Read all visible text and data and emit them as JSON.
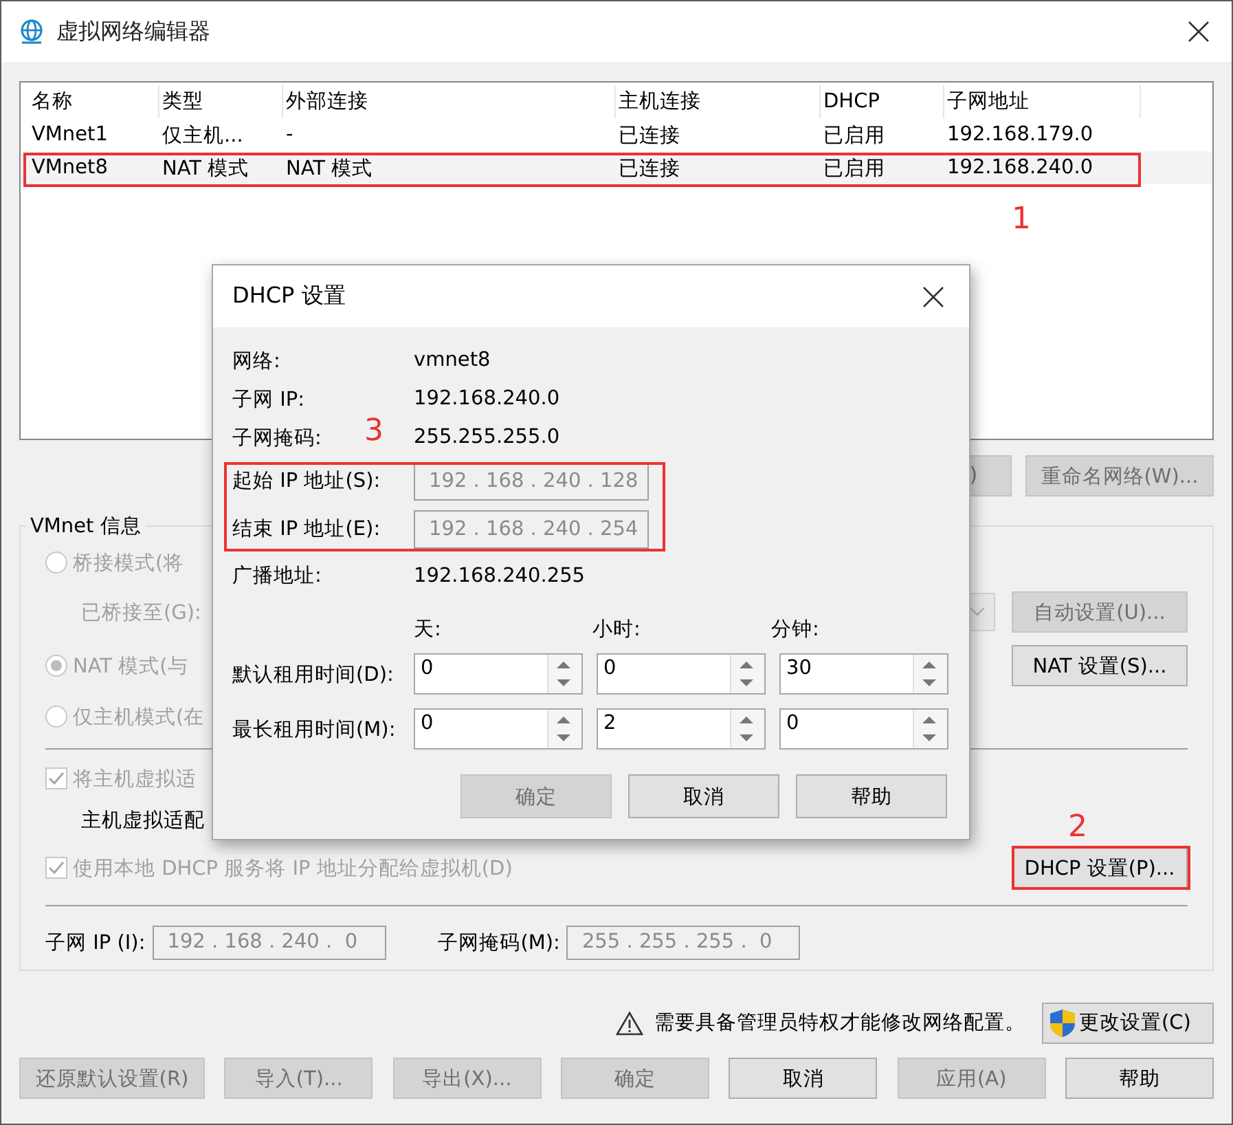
{
  "window": {
    "title": "虚拟网络编辑器"
  },
  "network_table": {
    "columns": [
      "名称",
      "类型",
      "外部连接",
      "主机连接",
      "DHCP",
      "子网地址"
    ],
    "rows": [
      {
        "cells": [
          "VMnet1",
          "仅主机...",
          "-",
          "已连接",
          "已启用",
          "192.168.179.0"
        ],
        "selected": false
      },
      {
        "cells": [
          "VMnet8",
          "NAT 模式",
          "NAT 模式",
          "已连接",
          "已启用",
          "192.168.240.0"
        ],
        "selected": true
      }
    ]
  },
  "network_buttons": [
    {
      "label": ")",
      "disabled": true
    },
    {
      "label": "重命名网络(W)...",
      "disabled": true
    }
  ],
  "vmnet_info": {
    "title": "VMnet 信息",
    "modes": [
      {
        "label": "桥接模式(将",
        "selected": false,
        "disabled": true
      },
      {
        "label": "NAT 模式(与",
        "selected": true,
        "disabled": true
      },
      {
        "label": "仅主机模式(在",
        "selected": false,
        "disabled": true
      }
    ],
    "bridged_to": {
      "label": "已桥接至(G):",
      "disabled": true
    },
    "auto_button": {
      "label": "自动设置(U)...",
      "disabled": true
    },
    "nat_button": {
      "label": "NAT 设置(S)...",
      "disabled": false
    },
    "connect_adapter": {
      "label": "将主机虚拟适",
      "checked": true,
      "disabled": true
    },
    "adapter_name": "主机虚拟适配",
    "use_dhcp": {
      "label": "使用本地 DHCP 服务将 IP 地址分配给虚拟机(D)",
      "checked": true,
      "disabled": true
    },
    "dhcp_button": {
      "label": "DHCP 设置(P)...",
      "disabled": false
    },
    "subnet_fields": [
      {
        "label": "子网 IP (I):",
        "value": "192 . 168 . 240 .  0",
        "disabled": true
      },
      {
        "label": "子网掩码(M):",
        "value": "255 . 255 . 255 .  0",
        "disabled": true
      }
    ]
  },
  "notice": {
    "text": "需要具备管理员特权才能修改网络配置。",
    "button": "更改设置(C)"
  },
  "footer_buttons": [
    {
      "label": "还原默认设置(R)",
      "disabled": true
    },
    {
      "label": "导入(T)...",
      "disabled": true
    },
    {
      "label": "导出(X)...",
      "disabled": true
    },
    {
      "label": "确定",
      "disabled": true
    },
    {
      "label": "取消",
      "disabled": false
    },
    {
      "label": "应用(A)",
      "disabled": true
    },
    {
      "label": "帮助",
      "disabled": false
    }
  ],
  "dhcp_dialog": {
    "title": "DHCP 设置",
    "info": [
      {
        "label": "网络:",
        "value": "vmnet8"
      },
      {
        "label": "子网 IP:",
        "value": "192.168.240.0"
      },
      {
        "label": "子网掩码:",
        "value": "255.255.255.0"
      }
    ],
    "range": [
      {
        "label": "起始 IP 地址(S):",
        "value": "192 . 168 . 240 . 128",
        "disabled": true
      },
      {
        "label": "结束 IP 地址(E):",
        "value": "192 . 168 . 240 . 254",
        "disabled": true
      }
    ],
    "broadcast": {
      "label": "广播地址:",
      "value": "192.168.240.255"
    },
    "lease_units": [
      "天:",
      "小时:",
      "分钟:"
    ],
    "leases": [
      {
        "label": "默认租用时间(D):",
        "values": [
          "0",
          "0",
          "30"
        ]
      },
      {
        "label": "最长租用时间(M):",
        "values": [
          "0",
          "2",
          "0"
        ]
      }
    ],
    "buttons": [
      {
        "label": "确定",
        "disabled": true
      },
      {
        "label": "取消",
        "disabled": false
      },
      {
        "label": "帮助",
        "disabled": false
      }
    ]
  },
  "annotations": [
    {
      "label": "1"
    },
    {
      "label": "2"
    },
    {
      "label": "3"
    }
  ]
}
